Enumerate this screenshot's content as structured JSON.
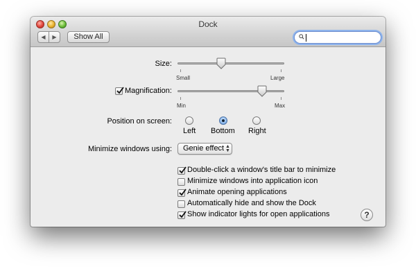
{
  "window": {
    "title": "Dock"
  },
  "toolbar": {
    "back_glyph": "◀",
    "forward_glyph": "▶",
    "show_all_label": "Show All",
    "search": {
      "value": "",
      "placeholder": ""
    }
  },
  "size": {
    "label": "Size:",
    "min_label": "Small",
    "max_label": "Large",
    "value_fraction": 0.4
  },
  "magnification": {
    "label": "Magnification:",
    "checked": true,
    "min_label": "Min",
    "max_label": "Max",
    "value_fraction": 0.82
  },
  "position": {
    "label": "Position on screen:",
    "options": [
      {
        "label": "Left",
        "selected": false
      },
      {
        "label": "Bottom",
        "selected": true
      },
      {
        "label": "Right",
        "selected": false
      }
    ]
  },
  "minimize": {
    "label": "Minimize windows using:",
    "selected": "Genie effect",
    "arrows": "⬍"
  },
  "options": [
    {
      "label": "Double-click a window's title bar to minimize",
      "checked": true
    },
    {
      "label": "Minimize windows into application icon",
      "checked": false
    },
    {
      "label": "Animate opening applications",
      "checked": true
    },
    {
      "label": "Automatically hide and show the Dock",
      "checked": false
    },
    {
      "label": "Show indicator lights for open applications",
      "checked": true
    }
  ],
  "help": {
    "glyph": "?"
  },
  "colors": {
    "accent": "#6f8fcf",
    "window_bg": "#ececec"
  }
}
